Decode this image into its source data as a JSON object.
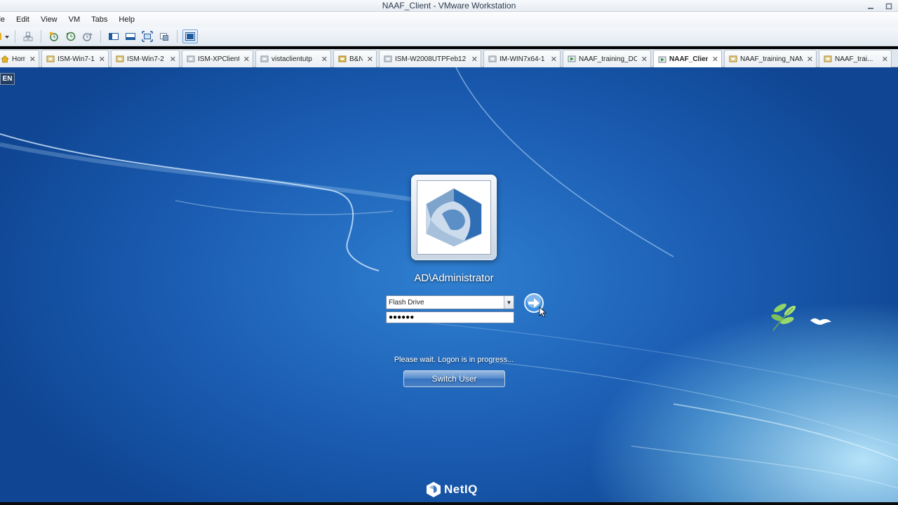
{
  "window": {
    "title": "NAAF_Client - VMware Workstation"
  },
  "menu": {
    "items": [
      "ile",
      "Edit",
      "View",
      "VM",
      "Tabs",
      "Help"
    ]
  },
  "tabs": [
    {
      "label": "Home",
      "active": false
    },
    {
      "label": "ISM-Win7-1",
      "active": false
    },
    {
      "label": "ISM-Win7-2",
      "active": false
    },
    {
      "label": "ISM-XPClient",
      "active": false
    },
    {
      "label": "vistaclientutp",
      "active": false
    },
    {
      "label": "B&N",
      "active": false
    },
    {
      "label": "ISM-W2008UTPFeb12",
      "active": false
    },
    {
      "label": "IM-WIN7x64-1",
      "active": false
    },
    {
      "label": "NAAF_training_DC",
      "active": false
    },
    {
      "label": "NAAF_Client",
      "active": true
    },
    {
      "label": "NAAF_training_NAM",
      "active": false
    },
    {
      "label": "NAAF_trai...",
      "active": false
    }
  ],
  "login": {
    "language_indicator": "EN",
    "username": "AD\\Administrator",
    "method_selected": "Flash Drive",
    "password_mask": "●●●●●●",
    "status": "Please wait. Logon is in progress...",
    "switch_user_label": "Switch User"
  },
  "brand": {
    "name": "NetIQ"
  },
  "colors": {
    "desktop_blue": "#1b5db3",
    "tab_active": "#ffffff",
    "tab_bar": "#dfe6ee"
  }
}
